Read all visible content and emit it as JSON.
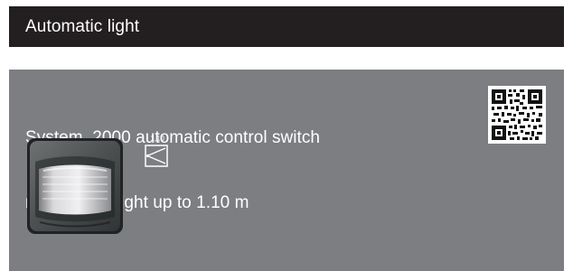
{
  "header": {
    "title": "Automatic light"
  },
  "product": {
    "title_line_1": "System  2000 automatic control switch",
    "title_line_2": "mounting height up to 1.10 m",
    "mounting_height_label": "1,10",
    "icons": {
      "qr_code": "qr-code",
      "device_image": "motion-detector-device-icon",
      "height_diagram": "mounting-height-icon"
    }
  },
  "colors": {
    "header_background": "#231f20",
    "panel_background": "#7d7e82",
    "text": "#ffffff"
  }
}
